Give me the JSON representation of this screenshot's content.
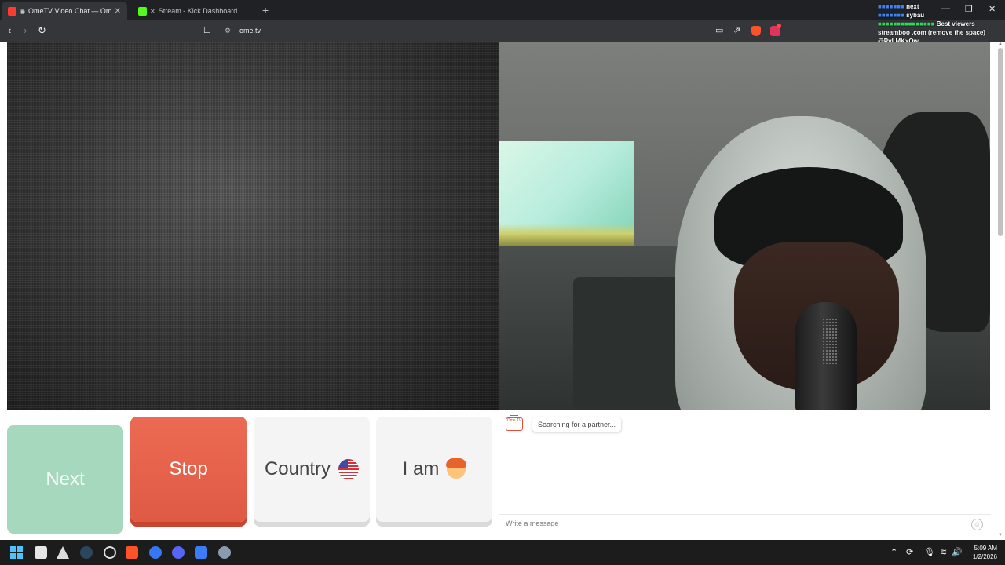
{
  "browser": {
    "tabs": [
      {
        "title": "OmeTV Video Chat — Omegl",
        "close": "✕"
      },
      {
        "title": "Stream - Kick Dashboard"
      }
    ],
    "new_tab": "+",
    "window_controls": {
      "minimize": "—",
      "restore": "❐",
      "close": "✕"
    },
    "nav": {
      "back": "‹",
      "forward": "›",
      "reload": "↻"
    },
    "url": "ome.tv",
    "bookmark_icon": "☐",
    "site_info_icon": "⚙",
    "tool_icons": [
      "cast-icon",
      "share-icon"
    ]
  },
  "stream_overlay": {
    "rows": [
      {
        "user": "",
        "text": "next"
      },
      {
        "user": "",
        "text": "sybau"
      },
      {
        "user": "",
        "text": "Best viewers"
      },
      {
        "user": "",
        "text": "streamboo .com (remove the space)"
      },
      {
        "user": "",
        "text": "@PyLMKxQw"
      }
    ]
  },
  "controls": {
    "next": "Next",
    "stop": "Stop",
    "country": "Country",
    "country_flag": "us-flag-icon",
    "iam": "I am",
    "iam_avatar": "boy-avatar-icon"
  },
  "chat": {
    "logo_text": "Ome TV",
    "status": "Searching for a partner...",
    "message_placeholder": "Write a message",
    "emoji_icon": "☺"
  },
  "taskbar": {
    "time": "5:09 AM",
    "date": "1/2/2026"
  },
  "colors": {
    "next_button": "#a5d8bd",
    "stop_button": "#df5a44",
    "neutral_button": "#f4f4f4",
    "brand_red": "#e84d3a"
  }
}
